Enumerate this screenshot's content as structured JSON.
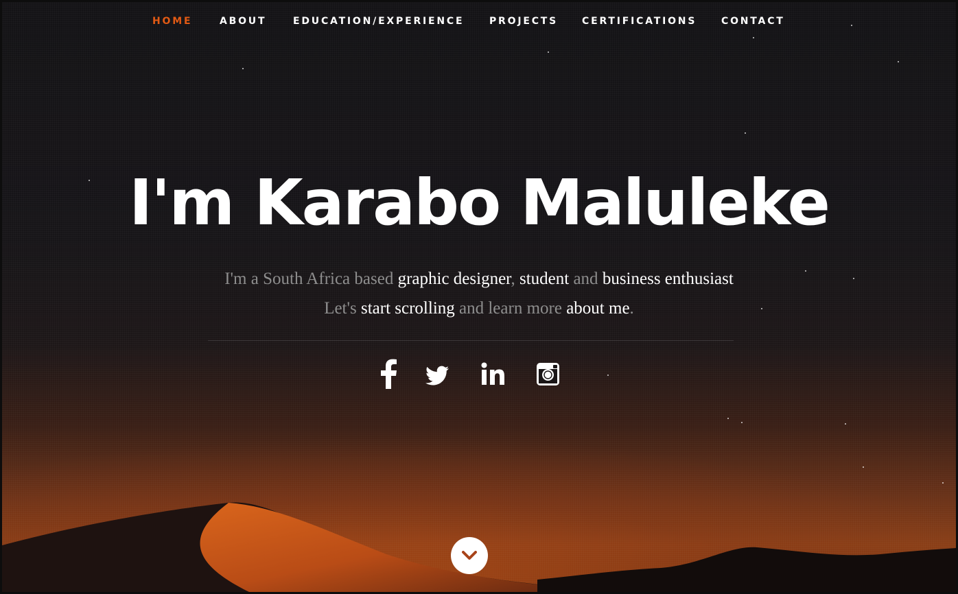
{
  "nav": {
    "items": [
      {
        "label": "HOME",
        "active": true
      },
      {
        "label": "ABOUT",
        "active": false
      },
      {
        "label": "EDUCATION/EXPERIENCE",
        "active": false
      },
      {
        "label": "PROJECTS",
        "active": false
      },
      {
        "label": "CERTIFICATIONS",
        "active": false
      },
      {
        "label": "CONTACT",
        "active": false
      }
    ]
  },
  "hero": {
    "title": "I'm Karabo Maluleke",
    "line1": {
      "p1": "I'm a South Africa based ",
      "h1": "graphic designer",
      "p2": ", ",
      "h2": "student",
      "p3": " and ",
      "h3": "business enthusiast"
    },
    "line2": {
      "p1": "Let's ",
      "h1": "start scrolling",
      "p2": " and learn more ",
      "h2": "about me",
      "p3": "."
    }
  },
  "social": [
    {
      "icon": "facebook-icon"
    },
    {
      "icon": "twitter-icon"
    },
    {
      "icon": "linkedin-icon"
    },
    {
      "icon": "instagram-icon"
    }
  ],
  "scroll_button": {
    "icon": "chevron-down-icon"
  },
  "colors": {
    "accent": "#e25a14",
    "text": "#ffffff",
    "muted_text": "#8e8e8e",
    "sky": "#151316",
    "dune": "#c2521a"
  }
}
